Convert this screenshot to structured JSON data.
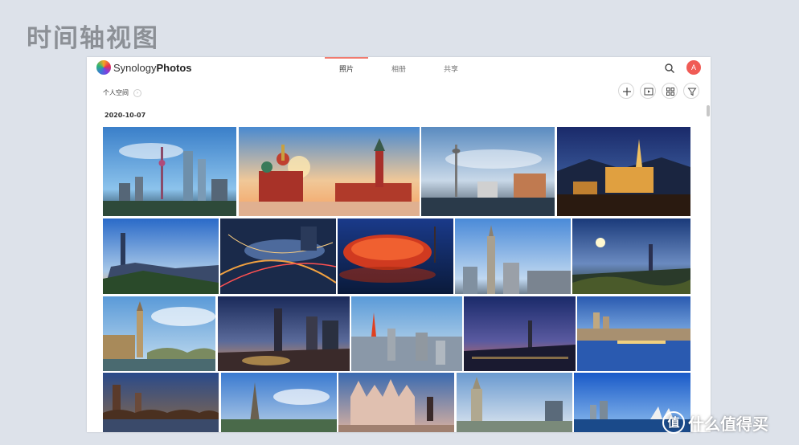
{
  "slide": {
    "title": "时间轴视图"
  },
  "app": {
    "brand_light": "Synology",
    "brand_bold": "Photos",
    "tabs": [
      {
        "label": "照片",
        "active": true
      },
      {
        "label": "相册",
        "active": false
      },
      {
        "label": "共享",
        "active": false
      }
    ],
    "avatar_letter": "A",
    "accent_color": "#f05b55"
  },
  "toolbar": {
    "space_label": "个人空间",
    "buttons": [
      "add-icon",
      "slideshow-icon",
      "grid-icon",
      "filter-icon"
    ]
  },
  "timeline": {
    "date": "2020-10-07",
    "rows": [
      [
        {
          "name": "photo-shanghai-skyline"
        },
        {
          "name": "photo-moscow-red-square"
        },
        {
          "name": "photo-dusseldorf-tower"
        },
        {
          "name": "photo-night-castle"
        }
      ],
      [
        {
          "name": "photo-taipei-101"
        },
        {
          "name": "photo-night-interchange"
        },
        {
          "name": "photo-birds-nest-stadium"
        },
        {
          "name": "photo-empire-state"
        },
        {
          "name": "photo-taipei-sunset"
        }
      ],
      [
        {
          "name": "photo-big-ben"
        },
        {
          "name": "photo-city-dusk"
        },
        {
          "name": "photo-tokyo-tower"
        },
        {
          "name": "photo-taipei-night"
        },
        {
          "name": "photo-zurich-river"
        }
      ],
      [
        {
          "name": "photo-prague-bridge"
        },
        {
          "name": "photo-eiffel-tower"
        },
        {
          "name": "photo-milan-cathedral"
        },
        {
          "name": "photo-warsaw-palace"
        },
        {
          "name": "photo-sydney-harbour"
        }
      ]
    ]
  },
  "watermark": {
    "text": "什么值得买",
    "icon": "值"
  }
}
